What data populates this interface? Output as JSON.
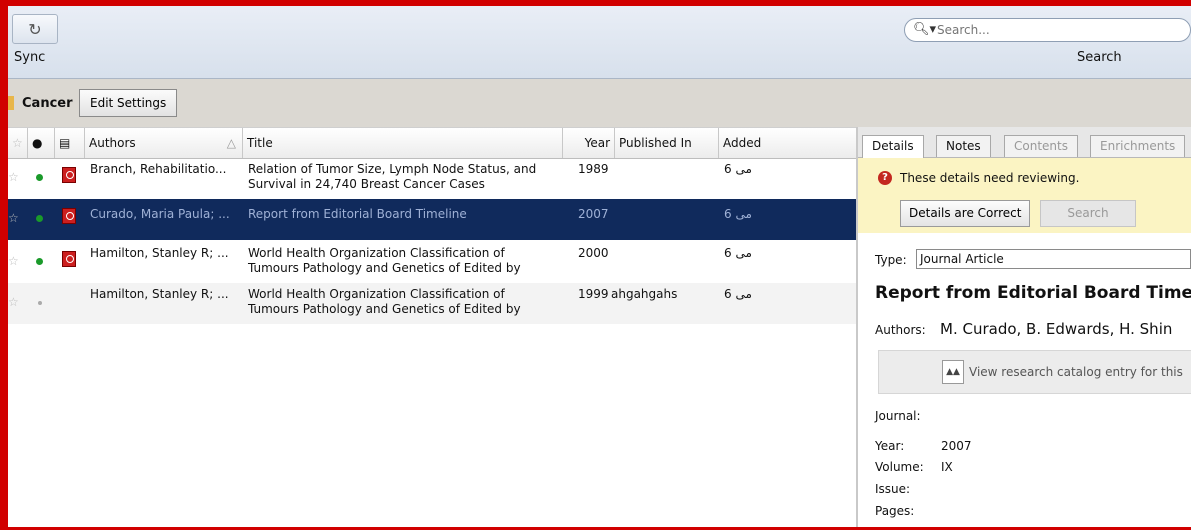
{
  "toolbar": {
    "sync_label": "Sync",
    "search_placeholder": "Search...",
    "search_label": "Search"
  },
  "collection": {
    "name": "Cancer",
    "edit_label": "Edit Settings"
  },
  "columns": {
    "authors": "Authors",
    "title": "Title",
    "year": "Year",
    "published_in": "Published In",
    "added": "Added"
  },
  "rows": [
    {
      "authors": "Branch, Rehabilitatio...",
      "title": "Relation of Tumor Size, Lymph Node Status, and Survival in 24,740 Breast Cancer Cases",
      "year": "1989",
      "published_in": "",
      "added": "6 مى"
    },
    {
      "authors": "Curado, Maria Paula; ...",
      "title": "Report from Editorial Board Timeline",
      "year": "2007",
      "published_in": "",
      "added": "6 مى"
    },
    {
      "authors": "Hamilton, Stanley R; ...",
      "title": "World Health Organization Classification of Tumours Pathology and Genetics of Edited by",
      "year": "2000",
      "published_in": "",
      "added": "6 مى"
    },
    {
      "authors": "Hamilton, Stanley R; ...",
      "title": "World Health Organization Classification of Tumours Pathology and Genetics of Edited by",
      "year": "1999",
      "published_in": "ahgahgahs",
      "added": "6 مى"
    }
  ],
  "detail": {
    "tabs": [
      "Details",
      "Notes",
      "Contents",
      "Enrichments"
    ],
    "review_message": "These details need reviewing.",
    "correct_button": "Details are Correct",
    "search_button": "Search",
    "type_label": "Type:",
    "type_value": "Journal Article",
    "title": "Report from Editorial Board Time",
    "authors_label": "Authors:",
    "authors_value": "M. Curado, B. Edwards, H. Shin",
    "catalog_text": "View research catalog entry for this",
    "journal_label": "Journal:",
    "year_label": "Year:",
    "year_value": "2007",
    "volume_label": "Volume:",
    "volume_value": "IX",
    "issue_label": "Issue:",
    "pages_label": "Pages:"
  }
}
